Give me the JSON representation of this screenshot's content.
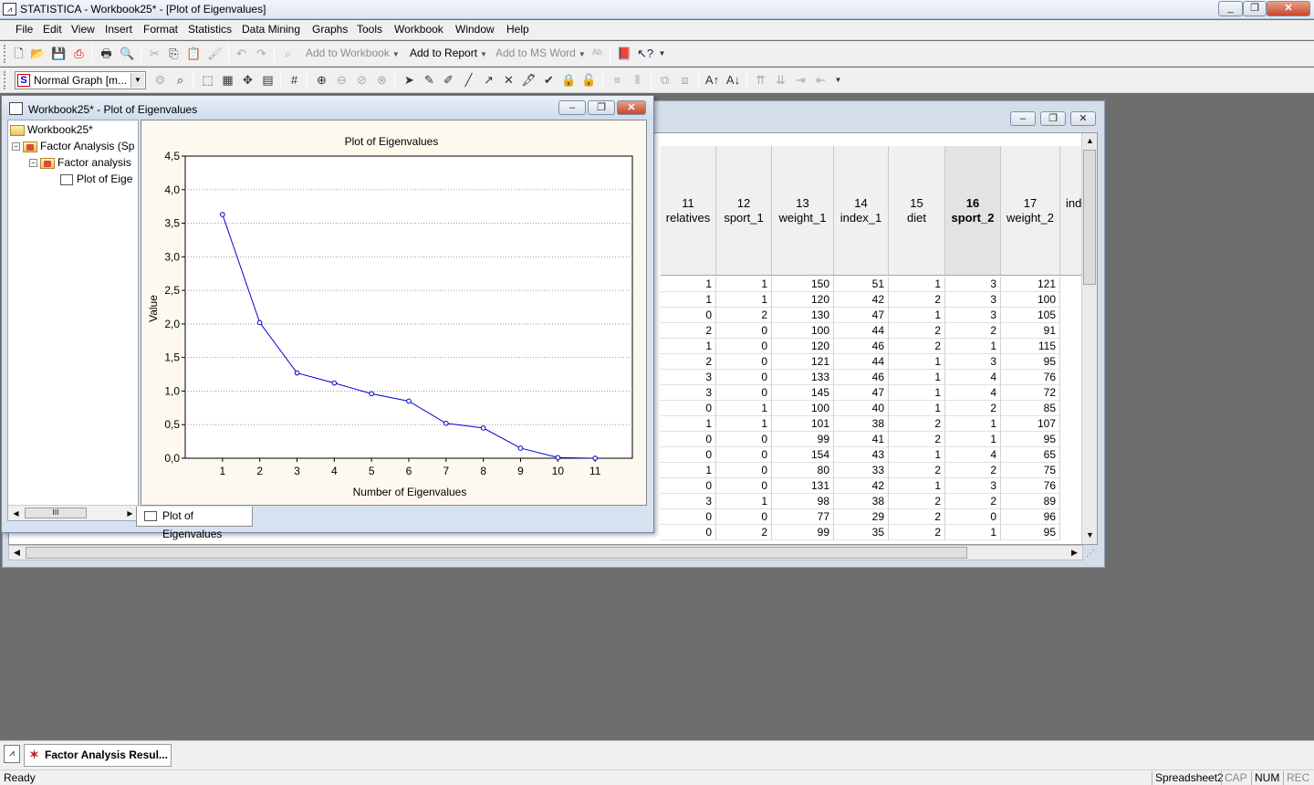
{
  "app": {
    "title": "STATISTICA - Workbook25* - [Plot of Eigenvalues]",
    "icon_name": "statistica-app-icon"
  },
  "menu": [
    "File",
    "Edit",
    "View",
    "Insert",
    "Format",
    "Statistics",
    "Data Mining",
    "Graphs",
    "Tools",
    "Workbook",
    "Window",
    "Help"
  ],
  "toolbar1": {
    "add_to_workbook": "Add to Workbook",
    "add_to_report": "Add to Report",
    "add_to_ms_word": "Add to MS Word"
  },
  "toolbar2": {
    "graph_style_combo": "Normal Graph [m..."
  },
  "graph_window": {
    "title": "Workbook25* - Plot of Eigenvalues",
    "tree": {
      "root": "Workbook25*",
      "level1": "Factor Analysis (Sp",
      "level2": "Factor analysis",
      "level3": "Plot of Eige"
    },
    "tab_label": "Plot of Eigenvalues"
  },
  "chart_data": {
    "type": "line",
    "title": "Plot of Eigenvalues",
    "xlabel": "Number of Eigenvalues",
    "ylabel": "Value",
    "x": [
      1,
      2,
      3,
      4,
      5,
      6,
      7,
      8,
      9,
      10,
      11
    ],
    "series": [
      {
        "values": [
          3.63,
          2.02,
          1.27,
          1.12,
          0.96,
          0.85,
          0.52,
          0.45,
          0.15,
          0.01,
          0.0
        ]
      }
    ],
    "xticks": [
      "1",
      "2",
      "3",
      "4",
      "5",
      "6",
      "7",
      "8",
      "9",
      "10",
      "11"
    ],
    "yticks": [
      "0,0",
      "0,5",
      "1,0",
      "1,5",
      "2,0",
      "2,5",
      "3,0",
      "3,5",
      "4,0",
      "4,5"
    ],
    "xlim": [
      0,
      12
    ],
    "ylim": [
      0,
      4.5
    ],
    "grid": true,
    "line_color": "#0000cc",
    "background_color": "#fdf9ef"
  },
  "spreadsheet": {
    "columns": [
      {
        "num": "11",
        "name": "relatives"
      },
      {
        "num": "12",
        "name": "sport_1"
      },
      {
        "num": "13",
        "name": "weight_1"
      },
      {
        "num": "14",
        "name": "index_1"
      },
      {
        "num": "15",
        "name": "diet"
      },
      {
        "num": "16",
        "name": "sport_2",
        "selected": true
      },
      {
        "num": "17",
        "name": "weight_2"
      },
      {
        "num": "",
        "name": "ind"
      }
    ],
    "rows": [
      [
        "1",
        "1",
        "150",
        "51",
        "1",
        "3",
        "121"
      ],
      [
        "1",
        "1",
        "120",
        "42",
        "2",
        "3",
        "100"
      ],
      [
        "0",
        "2",
        "130",
        "47",
        "1",
        "3",
        "105"
      ],
      [
        "2",
        "0",
        "100",
        "44",
        "2",
        "2",
        "91"
      ],
      [
        "1",
        "0",
        "120",
        "46",
        "2",
        "1",
        "115"
      ],
      [
        "2",
        "0",
        "121",
        "44",
        "1",
        "3",
        "95"
      ],
      [
        "3",
        "0",
        "133",
        "46",
        "1",
        "4",
        "76"
      ],
      [
        "3",
        "0",
        "145",
        "47",
        "1",
        "4",
        "72"
      ],
      [
        "0",
        "1",
        "100",
        "40",
        "1",
        "2",
        "85"
      ],
      [
        "1",
        "1",
        "101",
        "38",
        "2",
        "1",
        "107"
      ],
      [
        "0",
        "0",
        "99",
        "41",
        "2",
        "1",
        "95"
      ],
      [
        "0",
        "0",
        "154",
        "43",
        "1",
        "4",
        "65"
      ],
      [
        "1",
        "0",
        "80",
        "33",
        "2",
        "2",
        "75"
      ],
      [
        "0",
        "0",
        "131",
        "42",
        "1",
        "3",
        "76"
      ],
      [
        "3",
        "1",
        "98",
        "38",
        "2",
        "2",
        "89"
      ],
      [
        "0",
        "0",
        "77",
        "29",
        "2",
        "0",
        "96"
      ],
      [
        "0",
        "2",
        "99",
        "35",
        "2",
        "1",
        "95"
      ]
    ]
  },
  "taskbar": {
    "item": "Factor Analysis Resul..."
  },
  "status": {
    "ready": "Ready",
    "panels": [
      "Spreadsheet2",
      "CAP",
      "NUM",
      "REC"
    ]
  }
}
